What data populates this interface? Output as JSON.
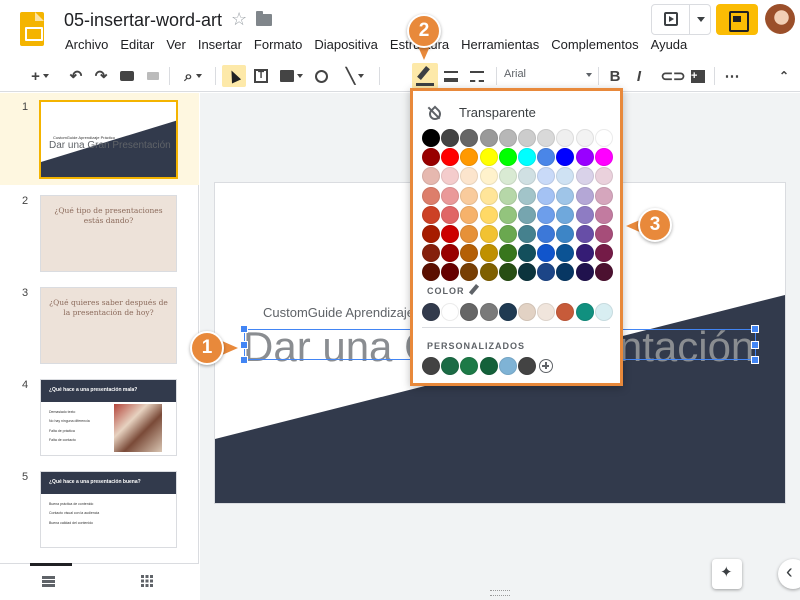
{
  "app": {
    "doc_title": "05-insertar-word-art",
    "menu": [
      "Archivo",
      "Editar",
      "Ver",
      "Insertar",
      "Formato",
      "Diapositiva",
      "Estructura",
      "Herramientas",
      "Complementos",
      "Ayuda"
    ]
  },
  "toolbar": {
    "font": "Arial",
    "buttons": [
      "new-slide",
      "undo",
      "redo",
      "print",
      "paint-format",
      "zoom",
      "select",
      "text-box",
      "image",
      "shape",
      "line",
      "fill-color",
      "border-color",
      "border-weight",
      "border-dash",
      "bold",
      "italic",
      "link",
      "comment",
      "more"
    ]
  },
  "filmstrip": {
    "slides": [
      {
        "num": "1",
        "kind": "title",
        "small": "CustomGuide Aprendizaje Práctico",
        "big": "Dar una Gran Presentación"
      },
      {
        "num": "2",
        "kind": "question",
        "text": "¿Qué tipo de presentaciones estás dando?"
      },
      {
        "num": "3",
        "kind": "question",
        "text": "¿Qué quieres saber después de la presentación de hoy?"
      },
      {
        "num": "4",
        "kind": "bar",
        "text": "¿Qué hace a una presentación mala?",
        "bullets": [
          "Demasiado texto",
          "No hay ninguna diferencia",
          "Falta de práctica",
          "Falta de contacto"
        ]
      },
      {
        "num": "5",
        "kind": "bar",
        "text": "¿Qué hace a una presentación buena?",
        "bullets": [
          "Buena práctica de contenido",
          "Contacto visual con la audiencia",
          "Buena calidad del contenido"
        ]
      }
    ]
  },
  "slide": {
    "subtitle": "CustomGuide Aprendizaje Práctico",
    "title": "Dar una Gran Presentación"
  },
  "color_popup": {
    "transparent_label": "Transparente",
    "color_label": "COLOR",
    "custom_label": "PERSONALIZADOS",
    "palette": [
      [
        "#000000",
        "#434343",
        "#666666",
        "#999999",
        "#b7b7b7",
        "#cccccc",
        "#d9d9d9",
        "#efefef",
        "#f3f3f3",
        "#ffffff"
      ],
      [
        "#980000",
        "#ff0000",
        "#ff9900",
        "#ffff00",
        "#00ff00",
        "#00ffff",
        "#4a86e8",
        "#0000ff",
        "#9900ff",
        "#ff00ff"
      ],
      [
        "#e6b8af",
        "#f4cccc",
        "#fce5cd",
        "#fff2cc",
        "#d9ead3",
        "#d0e0e3",
        "#c9daf8",
        "#cfe2f3",
        "#d9d2e9",
        "#ead1dc"
      ],
      [
        "#dd7e6b",
        "#ea9999",
        "#f9cb9c",
        "#ffe599",
        "#b6d7a8",
        "#a2c4c9",
        "#a4c2f4",
        "#9fc5e8",
        "#b4a7d6",
        "#d5a6bd"
      ],
      [
        "#cc4125",
        "#e06666",
        "#f6b26b",
        "#ffd966",
        "#93c47d",
        "#76a5af",
        "#6d9eeb",
        "#6fa8dc",
        "#8e7cc3",
        "#c27ba0"
      ],
      [
        "#a61c00",
        "#cc0000",
        "#e69138",
        "#f1c232",
        "#6aa84f",
        "#45818e",
        "#3c78d8",
        "#3d85c6",
        "#674ea7",
        "#a64d79"
      ],
      [
        "#85200c",
        "#990000",
        "#b45f06",
        "#bf9000",
        "#38761d",
        "#134f5c",
        "#1155cc",
        "#0b5394",
        "#351c75",
        "#741b47"
      ],
      [
        "#5b0f00",
        "#660000",
        "#783f04",
        "#7f6000",
        "#274e13",
        "#0c343d",
        "#1c4587",
        "#073763",
        "#20124d",
        "#4c1130"
      ]
    ],
    "theme_colors": [
      "#323a4c",
      "#ffffff",
      "#666666",
      "#7a7a7a",
      "#1f3a52",
      "#e2d2c4",
      "#f0e5dc",
      "#c75b3a",
      "#11907f",
      "#d8eef2"
    ],
    "custom_colors": [
      "#434343",
      "#1b6b45",
      "#1d7a47",
      "#14613a",
      "#7fb3d5",
      "#434343"
    ]
  },
  "callouts": [
    "1",
    "2",
    "3"
  ]
}
